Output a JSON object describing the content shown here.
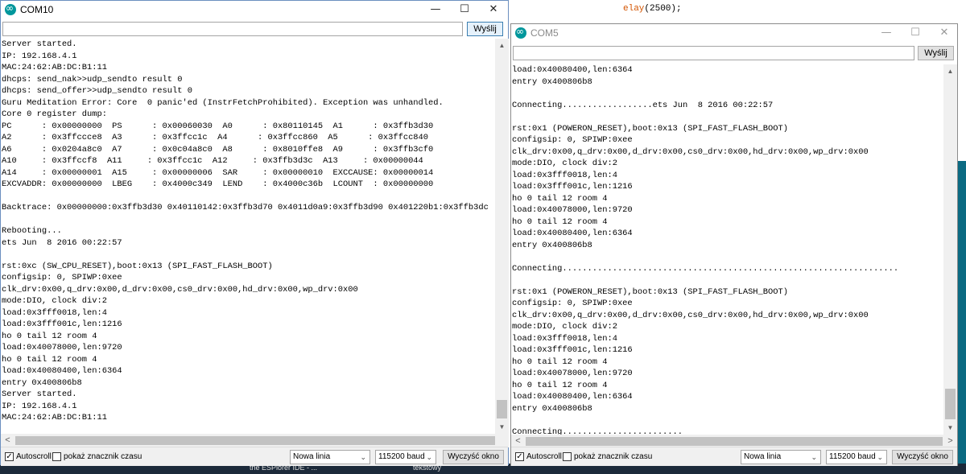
{
  "background": {
    "ide_code_prefix": "",
    "ide_code_fn": "elay",
    "ide_code_rest": "(2500);",
    "taskbar_left": "the ESPlorer IDE - ...",
    "taskbar_right": "tekstowy"
  },
  "com10": {
    "title": "COM10",
    "send_label": "Wyślij",
    "input_value": "",
    "autoscroll_label": "Autoscroll",
    "autoscroll_checked": true,
    "timestamp_label": "pokaż znacznik czasu",
    "line_ending": "Nowa linia",
    "baud": "115200 baud",
    "clear_label": "Wyczyść okno",
    "lines": [
      "Server started.",
      "IP: 192.168.4.1",
      "MAC:24:62:AB:DC:B1:11",
      "dhcps: send_nak>>udp_sendto result 0",
      "dhcps: send_offer>>udp_sendto result 0",
      "Guru Meditation Error: Core  0 panic'ed (InstrFetchProhibited). Exception was unhandled.",
      "Core 0 register dump:",
      "PC      : 0x00000000  PS      : 0x00060030  A0      : 0x80110145  A1      : 0x3ffb3d30",
      "A2      : 0x3ffccce8  A3      : 0x3ffcc1c  A4      : 0x3ffcc860  A5      : 0x3ffcc840",
      "A6      : 0x0204a8c0  A7      : 0x0c04a8c0  A8      : 0x8010ffe8  A9      : 0x3ffb3cf0",
      "A10     : 0x3ffccf8  A11     : 0x3ffcc1c  A12     : 0x3ffb3d3c  A13     : 0x00000044",
      "A14     : 0x00000001  A15     : 0x00000006  SAR     : 0x00000010  EXCCAUSE: 0x00000014",
      "EXCVADDR: 0x00000000  LBEG    : 0x4000c349  LEND    : 0x4000c36b  LCOUNT  : 0x00000000",
      "",
      "Backtrace: 0x00000000:0x3ffb3d30 0x40110142:0x3ffb3d70 0x4011d0a9:0x3ffb3d90 0x401220b1:0x3ffb3dc",
      "",
      "Rebooting...",
      "ets Jun  8 2016 00:22:57",
      "",
      "rst:0xc (SW_CPU_RESET),boot:0x13 (SPI_FAST_FLASH_BOOT)",
      "configsip: 0, SPIWP:0xee",
      "clk_drv:0x00,q_drv:0x00,d_drv:0x00,cs0_drv:0x00,hd_drv:0x00,wp_drv:0x00",
      "mode:DIO, clock div:2",
      "load:0x3fff0018,len:4",
      "load:0x3fff001c,len:1216",
      "ho 0 tail 12 room 4",
      "load:0x40078000,len:9720",
      "ho 0 tail 12 room 4",
      "load:0x40080400,len:6364",
      "entry 0x400806b8",
      "Server started.",
      "IP: 192.168.4.1",
      "MAC:24:62:AB:DC:B1:11"
    ]
  },
  "com5": {
    "title": "COM5",
    "send_label": "Wyślij",
    "input_value": "",
    "autoscroll_label": "Autoscroll",
    "autoscroll_checked": true,
    "timestamp_label": "pokaż znacznik czasu",
    "line_ending": "Nowa linia",
    "baud": "115200 baud",
    "clear_label": "Wyczyść okno",
    "lines": [
      "load:0x40080400,len:6364",
      "entry 0x400806b8",
      "",
      "Connecting..................ets Jun  8 2016 00:22:57",
      "",
      "rst:0x1 (POWERON_RESET),boot:0x13 (SPI_FAST_FLASH_BOOT)",
      "configsip: 0, SPIWP:0xee",
      "clk_drv:0x00,q_drv:0x00,d_drv:0x00,cs0_drv:0x00,hd_drv:0x00,wp_drv:0x00",
      "mode:DIO, clock div:2",
      "load:0x3fff0018,len:4",
      "load:0x3fff001c,len:1216",
      "ho 0 tail 12 room 4",
      "load:0x40078000,len:9720",
      "ho 0 tail 12 room 4",
      "load:0x40080400,len:6364",
      "entry 0x400806b8",
      "",
      "Connecting...................................................................",
      "",
      "rst:0x1 (POWERON_RESET),boot:0x13 (SPI_FAST_FLASH_BOOT)",
      "configsip: 0, SPIWP:0xee",
      "clk_drv:0x00,q_drv:0x00,d_drv:0x00,cs0_drv:0x00,hd_drv:0x00,wp_drv:0x00",
      "mode:DIO, clock div:2",
      "load:0x3fff0018,len:4",
      "load:0x3fff001c,len:1216",
      "ho 0 tail 12 room 4",
      "load:0x40078000,len:9720",
      "ho 0 tail 12 room 4",
      "load:0x40080400,len:6364",
      "entry 0x400806b8",
      "",
      "Connecting........................"
    ]
  },
  "icons": {
    "minimize": "—",
    "maximize": "☐",
    "close": "✕",
    "scroll_up": "▲",
    "scroll_down": "▼",
    "scroll_left": "<",
    "scroll_right": ">",
    "caret": "⌄",
    "check": "✓"
  },
  "colors": {
    "arduino_teal": "#00979c",
    "active_border": "#6b8fbf",
    "desktop": "#2b2b2b"
  }
}
